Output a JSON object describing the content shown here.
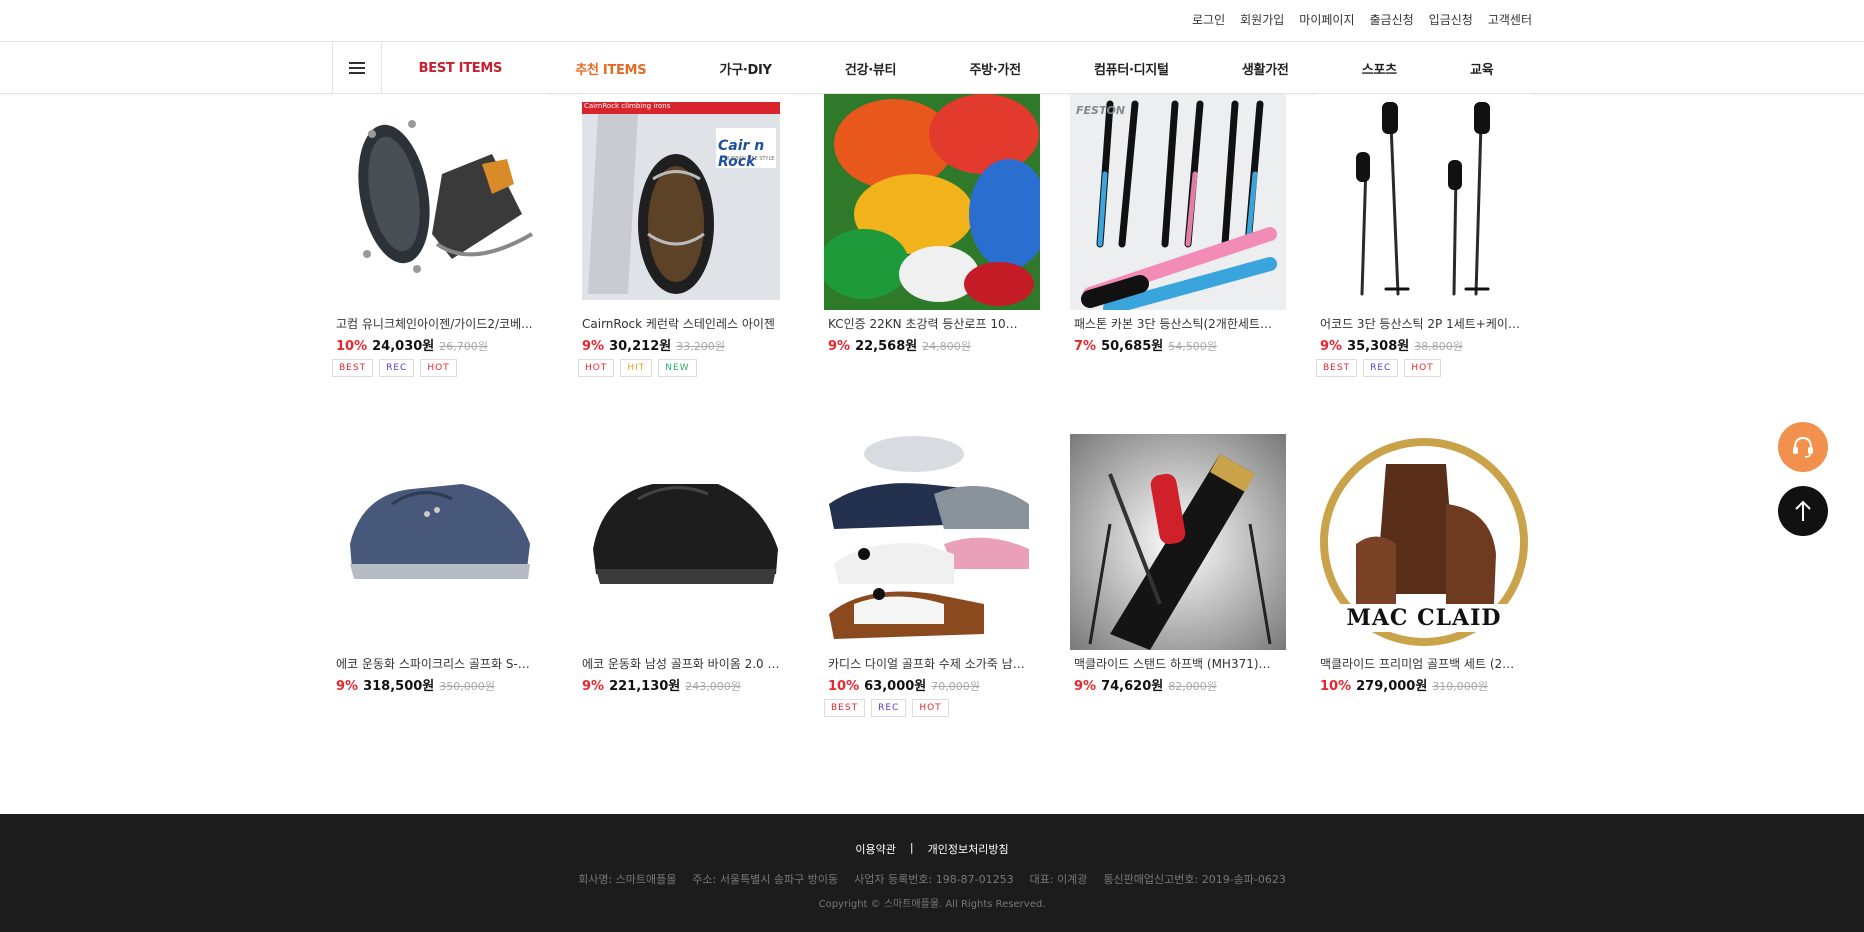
{
  "header": {
    "links": [
      "로그인",
      "회원가입",
      "마이페이지",
      "출금신청",
      "입금신청",
      "고객센터"
    ]
  },
  "nav": {
    "items": [
      "BEST ITEMS",
      "추천 ITEMS",
      "가구·DIY",
      "건강·뷰티",
      "주방·가전",
      "컴퓨터·디지털",
      "생활가전",
      "스포츠",
      "교육"
    ]
  },
  "products": [
    {
      "name": "고컴 유니크체인아이젠/가이드2/코베...",
      "pct": "10%",
      "price": "24,030원",
      "orig": "26,700원",
      "badges": [
        "BEST",
        "REC",
        "HOT"
      ],
      "thumb_text": ""
    },
    {
      "name": "CairnRock 케런락 스테인레스 아이젠",
      "pct": "9%",
      "price": "30,212원",
      "orig": "33,200원",
      "badges": [
        "HOT",
        "HIT",
        "NEW"
      ],
      "thumb_text": "Cair n Rock",
      "thumb_sub": "URBAN LIFE STYLE",
      "thumb_tag": "CairnRock  climbing irons"
    },
    {
      "name": "KC인증 22KN 초강력 등산로프 10mm ...",
      "pct": "9%",
      "price": "22,568원",
      "orig": "24,800원",
      "badges": [],
      "thumb_text": ""
    },
    {
      "name": "패스톤 카본 3단 등산스틱(2개한세트) ...",
      "pct": "7%",
      "price": "50,685원",
      "orig": "54,500원",
      "badges": [],
      "thumb_text": "FESTON"
    },
    {
      "name": "어코드 3단 등산스틱 2P 1세트+케이스 ...",
      "pct": "9%",
      "price": "35,308원",
      "orig": "38,800원",
      "badges": [
        "BEST",
        "REC",
        "HOT"
      ],
      "thumb_text": ""
    },
    {
      "name": "에코 운동화 스파이크리스 골프화 S-쓰...",
      "pct": "9%",
      "price": "318,500원",
      "orig": "350,000원",
      "badges": [],
      "thumb_text": ""
    },
    {
      "name": "에코 운동화 남성 골프화 바이옴 2.0 로...",
      "pct": "9%",
      "price": "221,130원",
      "orig": "243,000원",
      "badges": [],
      "thumb_text": ""
    },
    {
      "name": "카디스 다이얼 골프화 수제 소가죽 남성...",
      "pct": "10%",
      "price": "63,000원",
      "orig": "70,000원",
      "badges": [
        "BEST",
        "REC",
        "HOT"
      ],
      "thumb_text": ""
    },
    {
      "name": "맥클라이드 스탠드 하프백 (MH371) 골...",
      "pct": "9%",
      "price": "74,620원",
      "orig": "82,000원",
      "badges": [],
      "thumb_text": ""
    },
    {
      "name": "맥클라이드 프리미엄 골프백 세트 (202...",
      "pct": "10%",
      "price": "279,000원",
      "orig": "310,000원",
      "badges": [],
      "thumb_text": "MAC CLAID"
    }
  ],
  "footer": {
    "terms": "이용약관",
    "divider": "|",
    "privacy": "개인정보처리방침",
    "company": "회사명: 스마트애플몰",
    "address": "주소: 서울특별시 송파구 방이동",
    "bizno": "사업자 등록번호: 198-87-01253",
    "ceo": "대표: 이계광",
    "mailorder": "통신판매업신고번호: 2019-송파-0623",
    "copyright": "Copyright © 스마트애플몰. All Rights Reserved."
  },
  "colors": {
    "best": "#c8202f",
    "rec_nav": "#e46b23",
    "discount": "#e8262d",
    "cs_button": "#f2904e"
  },
  "icons": {
    "menu": "hamburger-icon",
    "cs": "headset-icon",
    "top": "arrow-up-icon"
  }
}
